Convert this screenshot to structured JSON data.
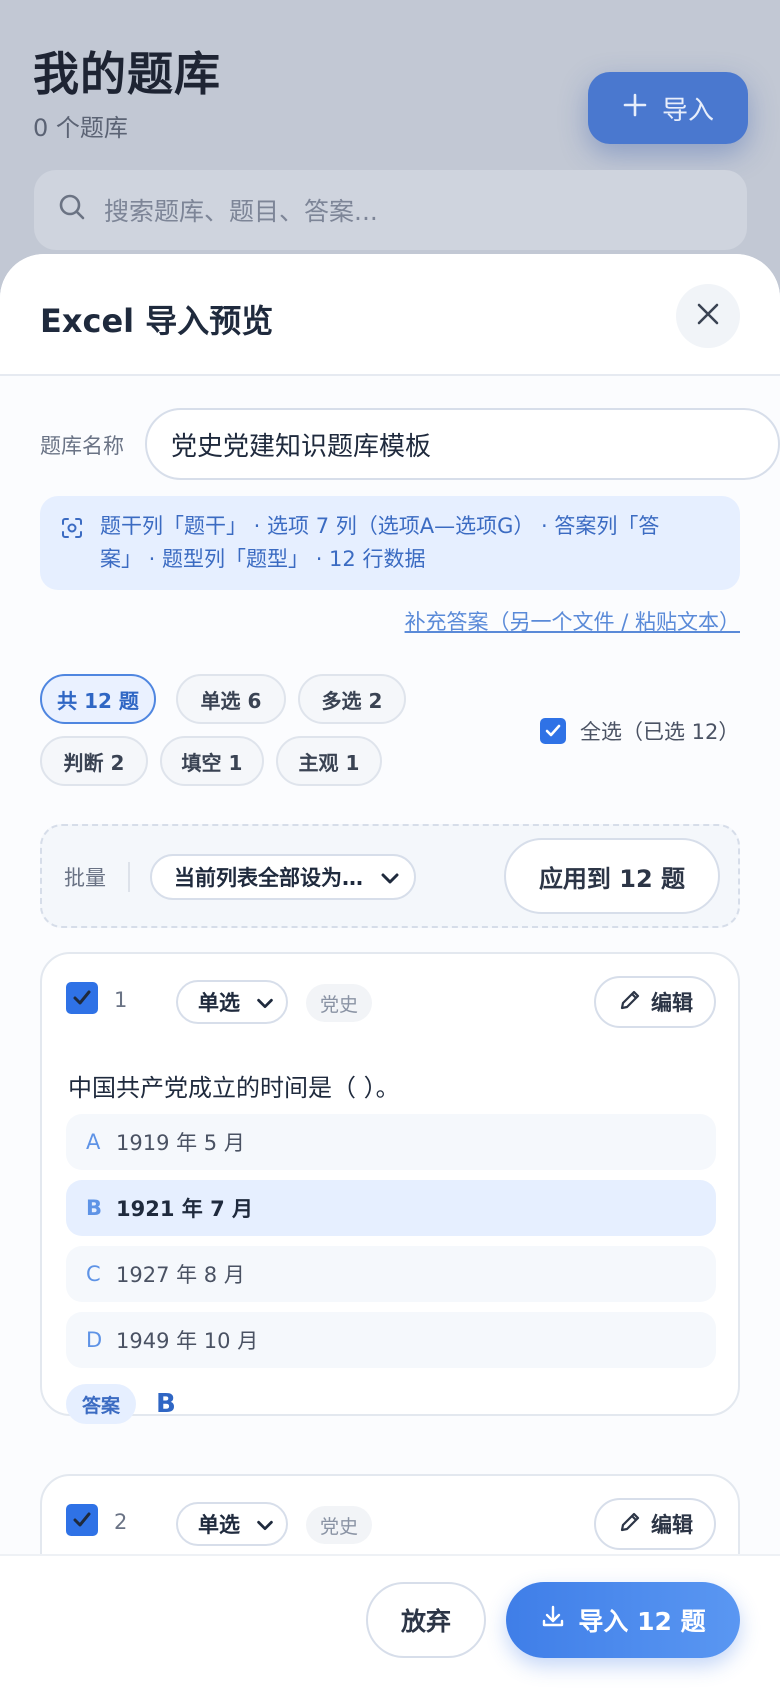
{
  "background": {
    "title": "我的题库",
    "subtitle": "0 个题库",
    "import_label": "导入",
    "search_placeholder": "搜索题库、题目、答案..."
  },
  "sheet": {
    "title": "Excel 导入预览",
    "bank_name_label": "题库名称",
    "bank_name_value": "党史党建知识题库模板",
    "info_line1": "题干列「题干」 · 选项 7 列（选项A—选项G） · 答案列「答",
    "info_line2": "案」 · 题型列「题型」 · 12 行数据",
    "supplement_link": "补充答案（另一个文件 / 粘贴文本）",
    "chips": {
      "total": "共 12 题",
      "single": "单选 6",
      "multi": "多选 2",
      "judge": "判断 2",
      "fill": "填空 1",
      "subjective": "主观 1"
    },
    "select_all": "全选（已选 12）",
    "batch": {
      "label": "批量",
      "select_value": "当前列表全部设为…",
      "apply": "应用到 12 题"
    },
    "questions": [
      {
        "num": "1",
        "type": "单选",
        "tag": "党史",
        "edit": "编辑",
        "stem": "中国共产党成立的时间是（ ）。",
        "options": [
          {
            "letter": "A",
            "text": "1919 年 5 月"
          },
          {
            "letter": "B",
            "text": "1921 年 7 月"
          },
          {
            "letter": "C",
            "text": "1927 年 8 月"
          },
          {
            "letter": "D",
            "text": "1949 年 10 月"
          }
        ],
        "answer_label": "答案",
        "answer": "B"
      },
      {
        "num": "2",
        "type": "单选",
        "tag": "党史",
        "edit": "编辑"
      }
    ],
    "footer": {
      "discard": "放弃",
      "import": "导入 12 题"
    }
  }
}
